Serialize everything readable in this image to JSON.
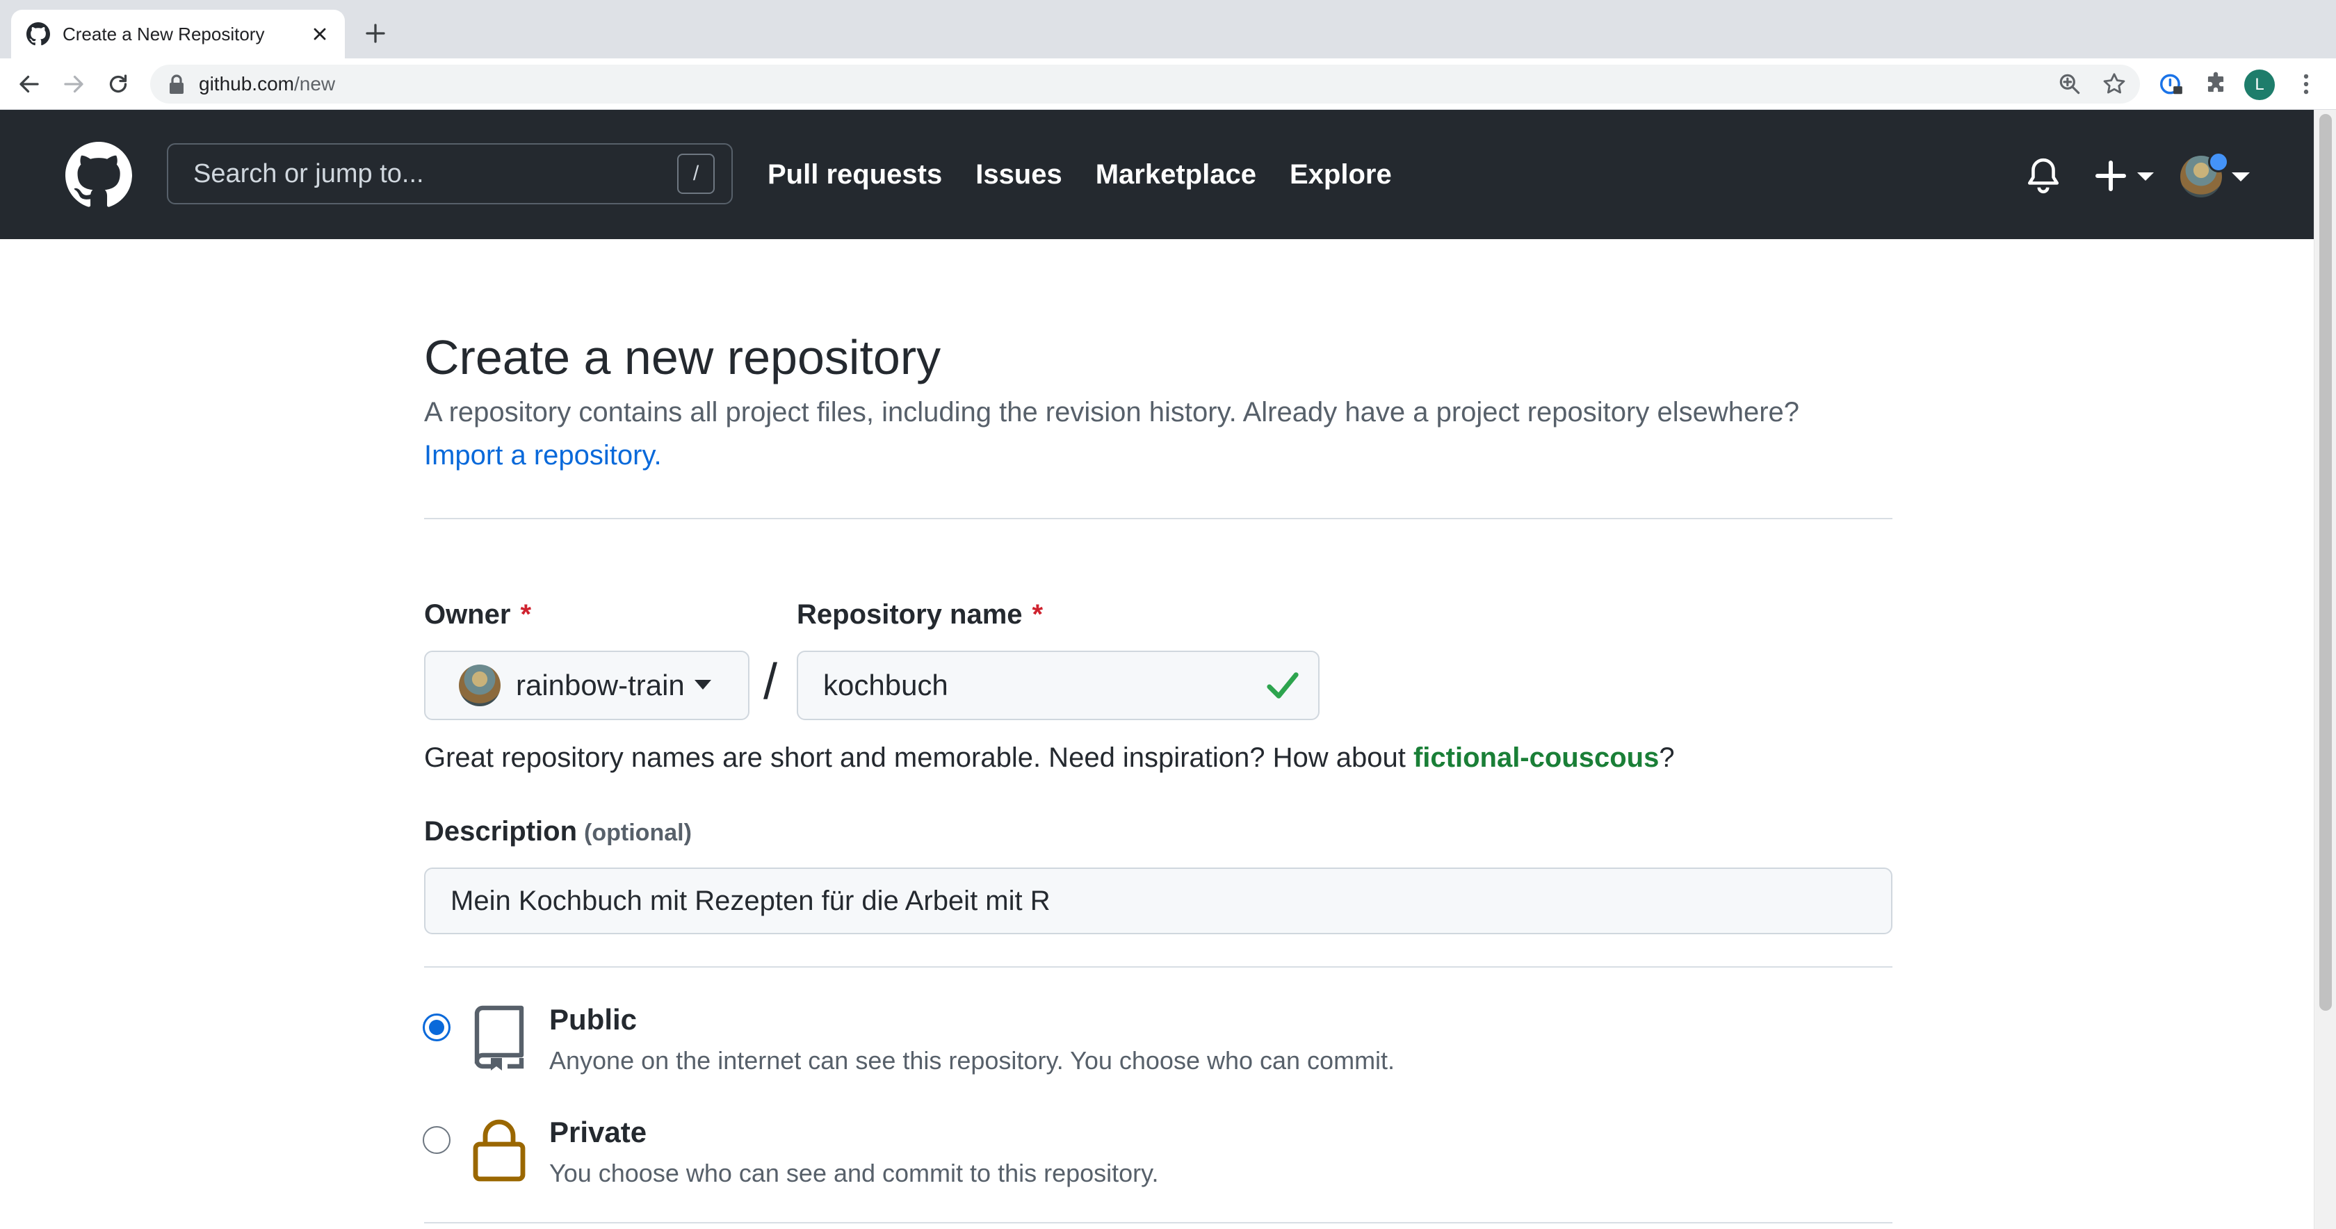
{
  "browser": {
    "tab_title": "Create a New Repository",
    "url_host": "github.com",
    "url_path": "/new",
    "profile_initial": "L"
  },
  "header": {
    "search_placeholder": "Search or jump to...",
    "search_shortcut": "/",
    "nav": [
      "Pull requests",
      "Issues",
      "Marketplace",
      "Explore"
    ]
  },
  "page": {
    "title": "Create a new repository",
    "subtitle": "A repository contains all project files, including the revision history. Already have a project repository elsewhere?",
    "import_link": "Import a repository."
  },
  "form": {
    "owner_label": "Owner",
    "required_mark": "*",
    "owner_value": "rainbow-train",
    "separator": "/",
    "repo_label": "Repository name",
    "repo_value": "kochbuch",
    "hint_prefix": "Great repository names are short and memorable. Need inspiration? How about",
    "hint_suggestion": "fictional-couscous",
    "hint_suffix": "?",
    "description_label": "Description",
    "description_optional": "(optional)",
    "description_value": "Mein Kochbuch mit Rezepten für die Arbeit mit R"
  },
  "visibility": {
    "selected": "public",
    "public_title": "Public",
    "public_desc": "Anyone on the internet can see this repository. You choose who can commit.",
    "private_title": "Private",
    "private_desc": "You choose who can see and commit to this repository."
  },
  "colors": {
    "header_bg": "#24292f",
    "link": "#0969da",
    "success": "#1a7f37",
    "danger": "#cf222e",
    "lock_icon": "#9a6700"
  }
}
